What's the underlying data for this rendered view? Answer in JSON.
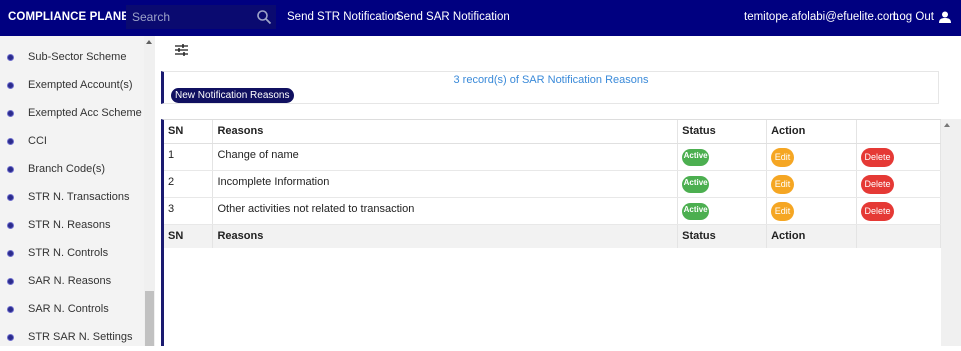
{
  "header": {
    "brand": "COMPLIANCE PLANET",
    "search_placeholder": "Search",
    "nav": [
      "Send STR Notification",
      "Send SAR Notification"
    ],
    "user_email": "temitope.afolabi@efuelite.com",
    "logout_label": "Log Out"
  },
  "sidebar": {
    "items": [
      {
        "label": "Sub-Sector Scheme"
      },
      {
        "label": "Exempted Account(s)"
      },
      {
        "label": "Exempted Acc Scheme"
      },
      {
        "label": "CCI"
      },
      {
        "label": "Branch Code(s)"
      },
      {
        "label": "STR N. Transactions"
      },
      {
        "label": "STR N. Reasons"
      },
      {
        "label": "STR N. Controls"
      },
      {
        "label": "SAR N. Reasons"
      },
      {
        "label": "SAR N. Controls"
      },
      {
        "label": "STR SAR N. Settings"
      }
    ]
  },
  "records": {
    "summary": "3 record(s) of SAR Notification Reasons",
    "new_button": "New Notification Reasons"
  },
  "table": {
    "columns": [
      "SN",
      "Reasons",
      "Status",
      "Action",
      ""
    ],
    "rows": [
      {
        "sn": "1",
        "reason": "Change of name",
        "status": "Active",
        "edit": "Edit",
        "delete": "Delete"
      },
      {
        "sn": "2",
        "reason": "Incomplete Information",
        "status": "Active",
        "edit": "Edit",
        "delete": "Delete"
      },
      {
        "sn": "3",
        "reason": "Other activities not related to transaction",
        "status": "Active",
        "edit": "Edit",
        "delete": "Delete"
      }
    ],
    "footer": [
      "SN",
      "Reasons",
      "Status",
      "Action",
      ""
    ]
  },
  "colors": {
    "topbar": "#000080",
    "active": "#4caf50",
    "edit": "#f5a623",
    "delete": "#e53935",
    "link": "#3a8ad9"
  }
}
